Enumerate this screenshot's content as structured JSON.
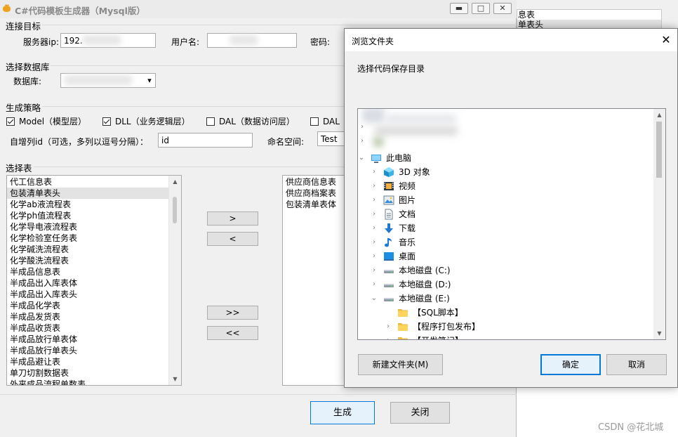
{
  "window": {
    "title": "C#代码模板生成器（Mysql版）",
    "controls": {
      "minimize": "▬",
      "maximize": "□",
      "close": "✕"
    }
  },
  "connection": {
    "section_title": "连接目标",
    "server_label": "服务器ip:",
    "server_value": "192.",
    "user_label": "用户名:",
    "password_label": "密码:"
  },
  "database": {
    "section_title": "选择数据库",
    "db_label": "数据库:",
    "dropdown_arrow": "▾"
  },
  "strategy": {
    "section_title": "生成策略",
    "options": [
      {
        "label": "Model（模型层）",
        "checked": true
      },
      {
        "label": "DLL（业务逻辑层）",
        "checked": true
      },
      {
        "label": "DAL（数据访问层）",
        "checked": false
      },
      {
        "label": "DAL（",
        "checked": false
      }
    ],
    "autoinc_label": "自增列id（可选，多列以逗号分隔）：",
    "autoinc_value": "id",
    "namespace_label": "命名空间:",
    "namespace_value": "Test"
  },
  "tables": {
    "section_title": "选择表",
    "available": [
      "代工信息表",
      "包装清单表头",
      "化学ab液流程表",
      "化学ph值流程表",
      "化学导电液流程表",
      "化学检验室任务表",
      "化学碱洗流程表",
      "化学酸洗流程表",
      "半成品信息表",
      "半成品出入库表体",
      "半成品出入库表头",
      "半成品化学表",
      "半成品发货表",
      "半成品收货表",
      "半成品放行单表体",
      "半成品放行单表头",
      "半成品避让表",
      "单刀切割数据表",
      "外来成品流程单数表"
    ],
    "selected_index": 1,
    "chosen": [
      "供应商信息表",
      "供应商档案表",
      "包装清单表体"
    ],
    "buttons": {
      "add": ">",
      "remove": "<",
      "add_all": ">>",
      "remove_all": "<<"
    }
  },
  "actions": {
    "generate": "生成",
    "close": "关闭"
  },
  "background": {
    "list_items": [
      "息表",
      "单表头"
    ]
  },
  "dialog": {
    "title": "浏览文件夹",
    "close_glyph": "✕",
    "description": "选择代码保存目录",
    "tree": [
      {
        "label": "此电脑",
        "icon": "computer-icon",
        "expanded": true
      },
      {
        "label": "3D 对象",
        "icon": "3d-objects-icon"
      },
      {
        "label": "视频",
        "icon": "video-icon"
      },
      {
        "label": "图片",
        "icon": "pictures-icon"
      },
      {
        "label": "文档",
        "icon": "documents-icon"
      },
      {
        "label": "下载",
        "icon": "download-icon"
      },
      {
        "label": "音乐",
        "icon": "music-icon"
      },
      {
        "label": "桌面",
        "icon": "desktop-icon"
      },
      {
        "label": "本地磁盘 (C:)",
        "icon": "drive-icon"
      },
      {
        "label": "本地磁盘 (D:)",
        "icon": "drive-icon"
      },
      {
        "label": "本地磁盘 (E:)",
        "icon": "drive-icon",
        "expanded": true
      },
      {
        "label": "【SQL脚本】",
        "icon": "folder-icon"
      },
      {
        "label": "【程序打包发布】",
        "icon": "folder-icon"
      },
      {
        "label": "【开发笔记】",
        "icon": "folder-icon"
      }
    ],
    "buttons": {
      "new_folder": "新建文件夹(M)",
      "ok": "确定",
      "cancel": "取消"
    }
  },
  "watermark": "CSDN @花北城",
  "colors": {
    "accent": "#0078d7",
    "folder": "#ffd35c",
    "title_gray": "#8a8a8a"
  }
}
